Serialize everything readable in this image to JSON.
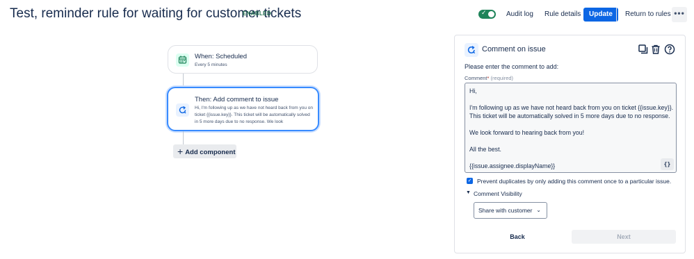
{
  "header": {
    "title": "Test, reminder rule for waiting for customer tickets",
    "status_badge": "ENABLED",
    "toggle_state": "on",
    "audit_log": "Audit log",
    "rule_details": "Rule details",
    "update": "Update",
    "return_to_rules": "Return to rules",
    "more": "•••"
  },
  "flow": {
    "trigger": {
      "icon": "calendar-icon",
      "title": "When: Scheduled",
      "subtitle": "Every 5 minutes"
    },
    "action": {
      "icon": "comment-refresh-icon",
      "title": "Then: Add comment to issue",
      "preview": "Hi, I'm following up as we have not heard back from you on ticket {{issue.key}}. This ticket will be automatically solved in 5 more days due to no response. We look"
    },
    "add_component": "Add component"
  },
  "panel": {
    "title": "Comment on issue",
    "icons": [
      "copy-icon",
      "trash-icon",
      "help-icon"
    ],
    "intro": "Please enter the comment to add:",
    "comment_label": "Comment",
    "required_star": "*",
    "required_hint": "(required)",
    "comment_lines": [
      "Hi,",
      "",
      "I'm following up as we have not heard back from you on ticket {{issue.key}}.",
      "This ticket will be automatically solved in 5 more days due to no response.",
      "",
      "We look forward to hearing back from you!",
      "",
      "All the best.",
      "",
      "{{issue.assignee.displayName}}"
    ],
    "smart_value_button": "{}",
    "prevent_duplicates_checked": true,
    "prevent_duplicates_label": "Prevent duplicates by only adding this comment once to a particular issue.",
    "visibility_label": "Comment Visibility",
    "visibility_value": "Share with customer",
    "back": "Back",
    "next": "Next"
  },
  "colors": {
    "primary": "#0c66e4",
    "success": "#1f845a",
    "selected_border": "#388bff"
  }
}
